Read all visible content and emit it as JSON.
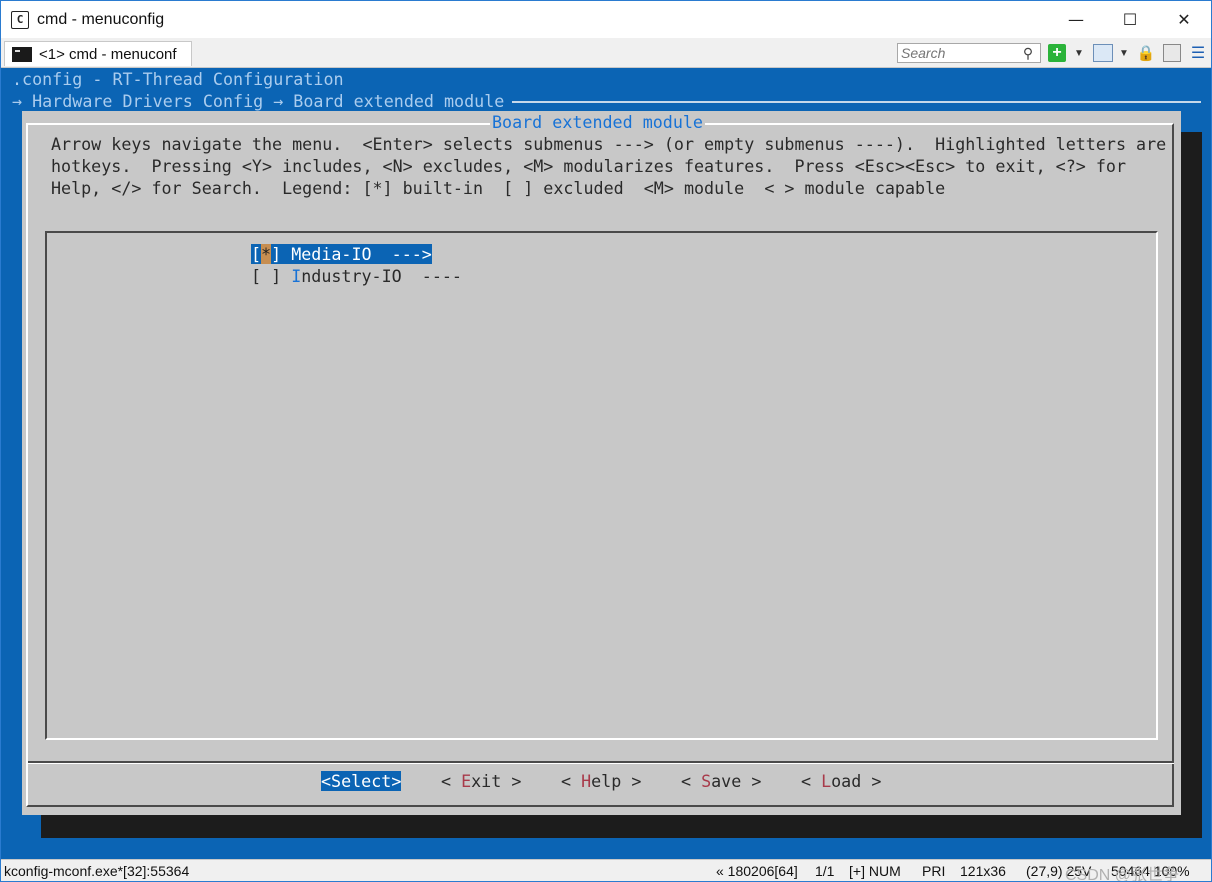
{
  "window": {
    "title": "cmd - menuconfig",
    "app_icon": "console-window-icon",
    "controls": {
      "minimize": "—",
      "maximize": "☐",
      "close": "✕"
    }
  },
  "tabbar": {
    "tab_label": "<1> cmd - menuconf",
    "search_placeholder": "Search"
  },
  "terminal": {
    "header_line1": ".config - RT-Thread Configuration",
    "header_line2": "→ Hardware Drivers Config → Board extended module",
    "dialog_title": "Board extended module",
    "help_lines": [
      "Arrow keys navigate the menu.  <Enter> selects submenus ---> (or empty submenus ----).  Highlighted letters are",
      "hotkeys.  Pressing <Y> includes, <N> excludes, <M> modularizes features.  Press <Esc><Esc> to exit, <?> for",
      "Help, </> for Search.  Legend: [*] built-in  [ ] excluded  <M> module  < > module capable"
    ],
    "menu_items": [
      {
        "prefix_open": "[",
        "state": "*",
        "prefix_close": "] ",
        "hotkey": "M",
        "rest": "edia-IO  --->",
        "selected": true
      },
      {
        "prefix_open": "[",
        "state": " ",
        "prefix_close": "] ",
        "hotkey": "I",
        "rest": "ndustry-IO  ----",
        "selected": false
      }
    ],
    "buttons": [
      {
        "label": "<Select>"
      },
      {
        "left": "< ",
        "hotkey": "E",
        "rest": "xit",
        "right": " >"
      },
      {
        "left": "< ",
        "hotkey": "H",
        "rest": "elp",
        "right": " >"
      },
      {
        "left": "< ",
        "hotkey": "S",
        "rest": "ave",
        "right": " >"
      },
      {
        "left": "< ",
        "hotkey": "L",
        "rest": "oad",
        "right": " >"
      }
    ]
  },
  "statusbar": {
    "process": "kconfig-mconf.exe*[32]:55364",
    "buffer": "« 180206[64]",
    "page": "1/1",
    "mode": "[+] NUM",
    "priority": "PRI",
    "size": "121x36",
    "cursor": "(27,9) 25V",
    "pid_zoom": "50464 100%",
    "watermark": "CSDN @张世争"
  },
  "colors": {
    "terminal_bg": "#0b64b4",
    "dialog_bg": "#c8c8c8",
    "title_accent": "#1772d6",
    "hotkey_red": "#a83a4a"
  }
}
